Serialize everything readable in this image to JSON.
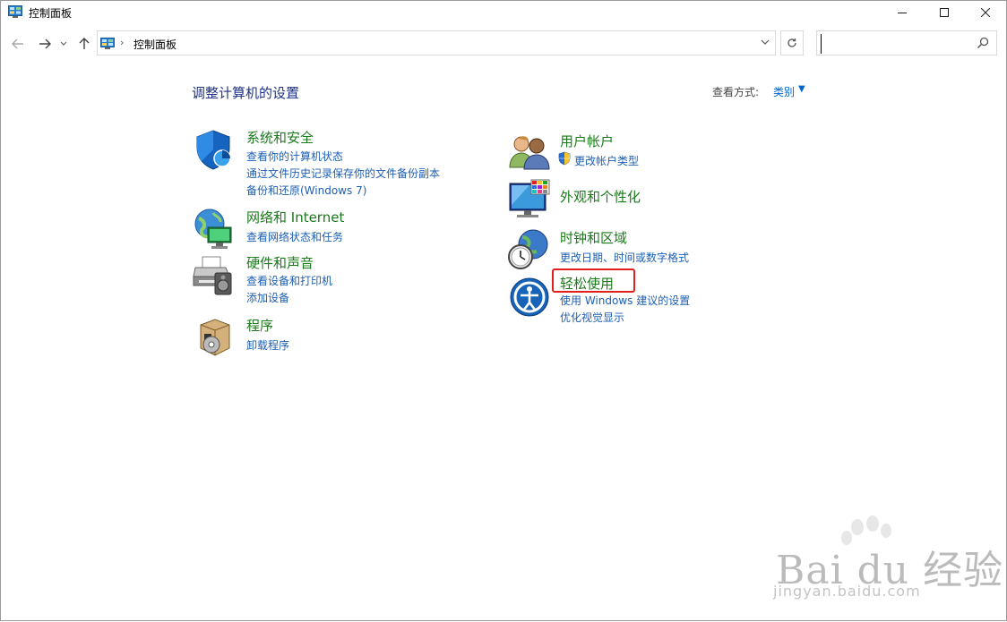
{
  "window": {
    "title": "控制面板",
    "minimize_icon": "minimize-icon",
    "maximize_icon": "maximize-icon",
    "close_icon": "close-icon"
  },
  "nav": {
    "back_icon": "arrow-left-icon",
    "forward_icon": "arrow-right-icon",
    "recent_icon": "chevron-down-icon",
    "up_icon": "arrow-up-icon",
    "address": {
      "breadcrumb_sep": "›",
      "crumb": "控制面板"
    },
    "search": {
      "placeholder": "",
      "value": ""
    }
  },
  "main": {
    "heading": "调整计算机的设置",
    "view_by_label": "查看方式:",
    "view_by_value": "类别"
  },
  "categories_left": [
    {
      "title": "系统和安全",
      "icon": "shield-icon",
      "links": [
        "查看你的计算机状态",
        "通过文件历史记录保存你的文件备份副本",
        "备份和还原(Windows 7)"
      ]
    },
    {
      "title": "网络和 Internet",
      "icon": "network-globe-icon",
      "links": [
        "查看网络状态和任务"
      ]
    },
    {
      "title": "硬件和声音",
      "icon": "printer-icon",
      "links": [
        "查看设备和打印机",
        "添加设备"
      ]
    },
    {
      "title": "程序",
      "icon": "programs-icon",
      "links": [
        "卸载程序"
      ]
    }
  ],
  "categories_right": [
    {
      "title": "用户帐户",
      "icon": "users-icon",
      "links": [
        "更改帐户类型"
      ]
    },
    {
      "title": "外观和个性化",
      "icon": "monitor-icon",
      "links": []
    },
    {
      "title": "时钟和区域",
      "icon": "clock-globe-icon",
      "links": [
        "更改日期、时间或数字格式"
      ]
    },
    {
      "title": "轻松使用",
      "icon": "ease-of-access-icon",
      "links": [
        "使用 Windows 建议的设置",
        "优化视觉显示"
      ]
    }
  ],
  "watermark": {
    "brand": "Bai du 经验",
    "url": "jingyan.baidu.com"
  },
  "colors": {
    "heading": "#1e3287",
    "category_title": "#1b7a1b",
    "link": "#1d5fb3",
    "highlight": "#e0201f"
  }
}
